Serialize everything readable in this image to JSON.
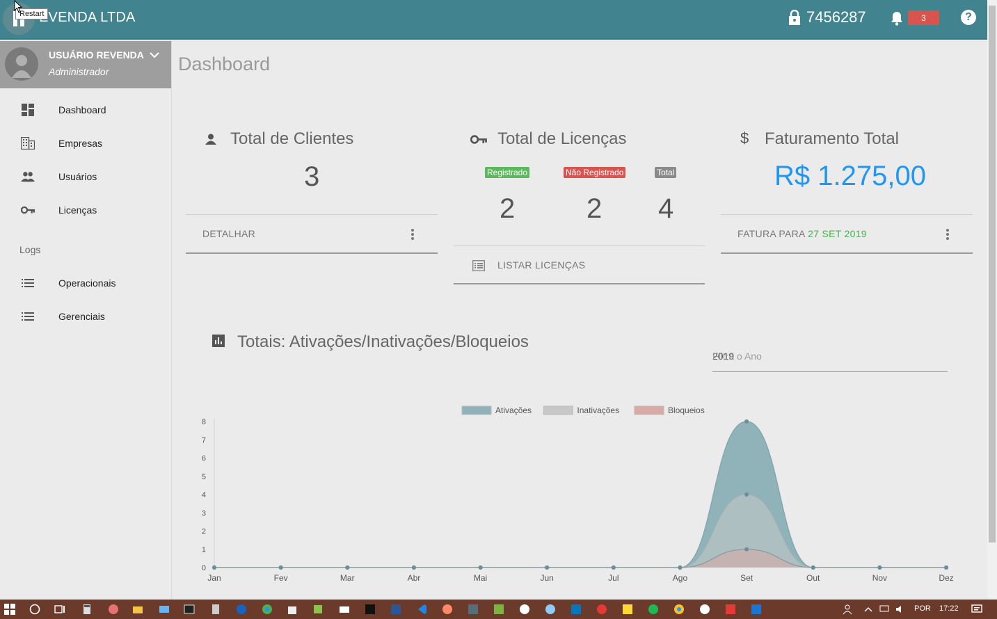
{
  "app": {
    "brand_name": "REVENDA LTDA",
    "brand_display": "EVENDA LTDA",
    "tooltip": "Restart",
    "license_code": "7456287",
    "notifications": "3",
    "help_label": "?"
  },
  "user": {
    "name": "USUÁRIO REVENDA",
    "role": "Administrador"
  },
  "sidebar": {
    "items": [
      {
        "label": "Dashboard",
        "icon": "dashboard-icon"
      },
      {
        "label": "Empresas",
        "icon": "building-icon"
      },
      {
        "label": "Usuários",
        "icon": "people-icon"
      },
      {
        "label": "Licenças",
        "icon": "key-icon"
      }
    ],
    "section_logs": "Logs",
    "logs_items": [
      {
        "label": "Operacionais",
        "icon": "list-icon"
      },
      {
        "label": "Gerenciais",
        "icon": "list-icon"
      }
    ]
  },
  "page": {
    "title": "Dashboard"
  },
  "cards": {
    "clients": {
      "title": "Total de Clientes",
      "value": "3",
      "action": "DETALHAR"
    },
    "licenses": {
      "title": "Total de Licenças",
      "badge_registered": "Registrado",
      "badge_unregistered": "Não Registrado",
      "badge_total": "Total",
      "registered": "2",
      "unregistered": "2",
      "total": "4",
      "action": "LISTAR LICENÇAS",
      "colors": {
        "registered": "#5cb85c",
        "unregistered": "#d9534f",
        "total": "#8a8a8a"
      }
    },
    "revenue": {
      "title": "Faturamento Total",
      "currency_symbol": "$",
      "value": "R$ 1.275,00",
      "action_prefix": "FATURA PARA",
      "action_date": "27 SET 2019"
    }
  },
  "chart_section": {
    "title": "Totais: Ativações/Inativações/Bloqueios",
    "year_value": "2019",
    "year_label": "Filtra o Ano"
  },
  "chart_data": {
    "type": "area",
    "categories": [
      "Jan",
      "Fev",
      "Mar",
      "Abr",
      "Mai",
      "Jun",
      "Jul",
      "Ago",
      "Set",
      "Out",
      "Nov",
      "Dez"
    ],
    "series": [
      {
        "name": "Ativações",
        "values": [
          0,
          0,
          0,
          0,
          0,
          0,
          0,
          0,
          8,
          0,
          0,
          0
        ],
        "color": "#8fb3b8"
      },
      {
        "name": "Inativações",
        "values": [
          0,
          0,
          0,
          0,
          0,
          0,
          0,
          0,
          4,
          0,
          0,
          0
        ],
        "color": "#c8c8c8"
      },
      {
        "name": "Bloqueios",
        "values": [
          0,
          0,
          0,
          0,
          0,
          0,
          0,
          0,
          1,
          0,
          0,
          0
        ],
        "color": "#d9aaa6"
      }
    ],
    "ylim": [
      0,
      8
    ],
    "yticks": [
      0,
      1,
      2,
      3,
      4,
      5,
      6,
      7,
      8
    ],
    "legend": "top-center",
    "grid": false
  },
  "taskbar": {
    "lang": "POR",
    "time": "17:22"
  }
}
